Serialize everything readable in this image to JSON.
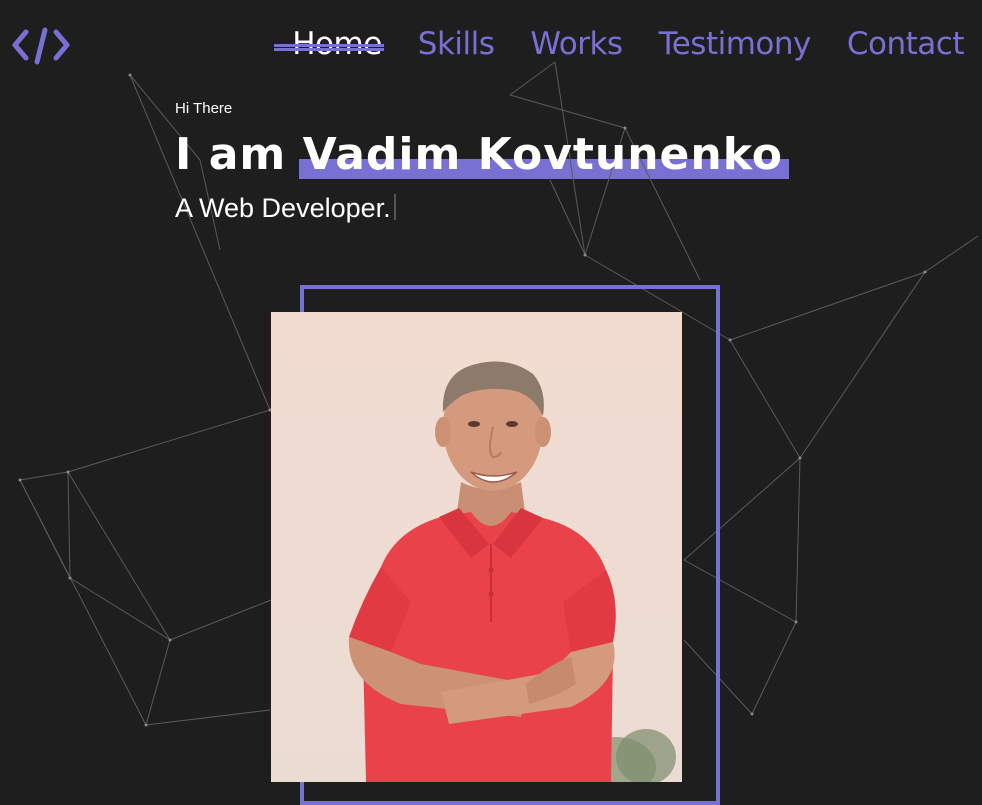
{
  "logo": {
    "icon": "code-brackets-icon",
    "color": "#7870d3"
  },
  "nav": {
    "items": [
      {
        "label": "Home",
        "active": true
      },
      {
        "label": "Skills",
        "active": false
      },
      {
        "label": "Works",
        "active": false
      },
      {
        "label": "Testimony",
        "active": false
      },
      {
        "label": "Contact",
        "active": false
      }
    ]
  },
  "hero": {
    "greeting": "Hi There",
    "headline_prefix": "I am",
    "name": "Vadim Kovtunenko",
    "role": "A Web Developer."
  },
  "photo": {
    "alt": "Portrait of Vadim Kovtunenko"
  },
  "colors": {
    "background": "#1e1e1e",
    "accent": "#7870d3",
    "text": "#ffffff"
  }
}
